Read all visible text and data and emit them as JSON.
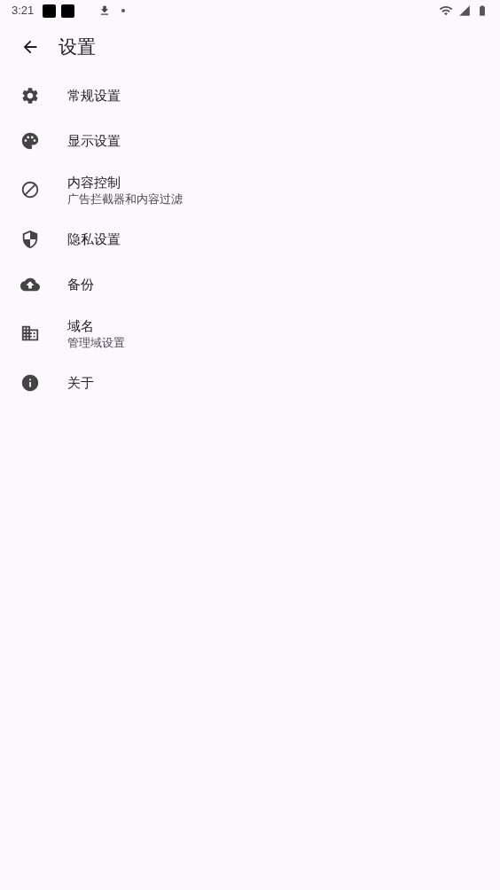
{
  "status_bar": {
    "time": "3:21"
  },
  "app_bar": {
    "title": "设置"
  },
  "items": [
    {
      "title": "常规设置"
    },
    {
      "title": "显示设置"
    },
    {
      "title": "内容控制",
      "subtitle": "广告拦截器和内容过滤"
    },
    {
      "title": "隐私设置"
    },
    {
      "title": "备份"
    },
    {
      "title": "域名",
      "subtitle": "管理域设置"
    },
    {
      "title": "关于"
    }
  ]
}
